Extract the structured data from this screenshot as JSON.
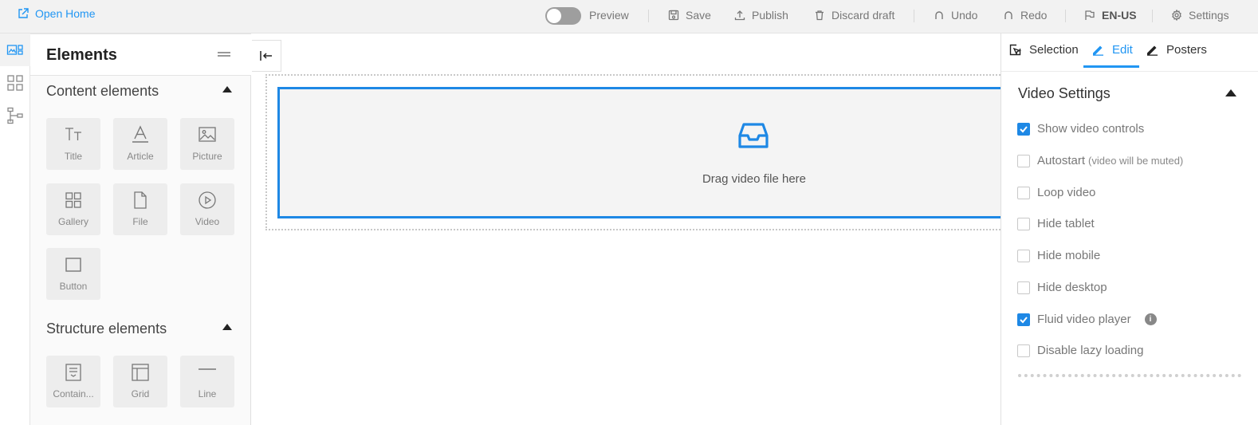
{
  "topbar": {
    "open_home": "Open Home",
    "preview": "Preview",
    "save": "Save",
    "publish": "Publish",
    "discard": "Discard draft",
    "undo": "Undo",
    "redo": "Redo",
    "language": "EN-US",
    "settings": "Settings"
  },
  "panel": {
    "title": "Elements",
    "content_section": "Content elements",
    "structure_section": "Structure elements",
    "content_items": [
      "Title",
      "Article",
      "Picture",
      "Gallery",
      "File",
      "Video",
      "Button"
    ],
    "structure_items": [
      "Contain...",
      "Grid",
      "Line"
    ]
  },
  "canvas": {
    "dropzone_text": "Drag video file here"
  },
  "right_panel": {
    "tabs": [
      "Selection",
      "Edit",
      "Posters"
    ],
    "active_tab": "Edit",
    "section_title": "Video Settings",
    "options": [
      {
        "label": "Show video controls",
        "checked": true
      },
      {
        "label": "Autostart",
        "note": "(video will be muted)",
        "checked": false
      },
      {
        "label": "Loop video",
        "checked": false
      },
      {
        "label": "Hide tablet",
        "checked": false
      },
      {
        "label": "Hide mobile",
        "checked": false
      },
      {
        "label": "Hide desktop",
        "checked": false
      },
      {
        "label": "Fluid video player",
        "checked": true,
        "info_icon": "i"
      },
      {
        "label": "Disable lazy loading",
        "checked": false
      }
    ]
  },
  "colors": {
    "accent": "#2196f3",
    "topbar_bg": "#f2f2f2",
    "tile_bg": "#ededed"
  },
  "icons": {
    "open_home": "external-link-icon",
    "save": "floppy-icon",
    "publish": "upload-icon",
    "discard": "trash-icon",
    "undo": "undo-icon",
    "redo": "redo-icon",
    "language": "flag-icon",
    "settings": "gear-icon",
    "dropzone": "inbox-icon"
  }
}
